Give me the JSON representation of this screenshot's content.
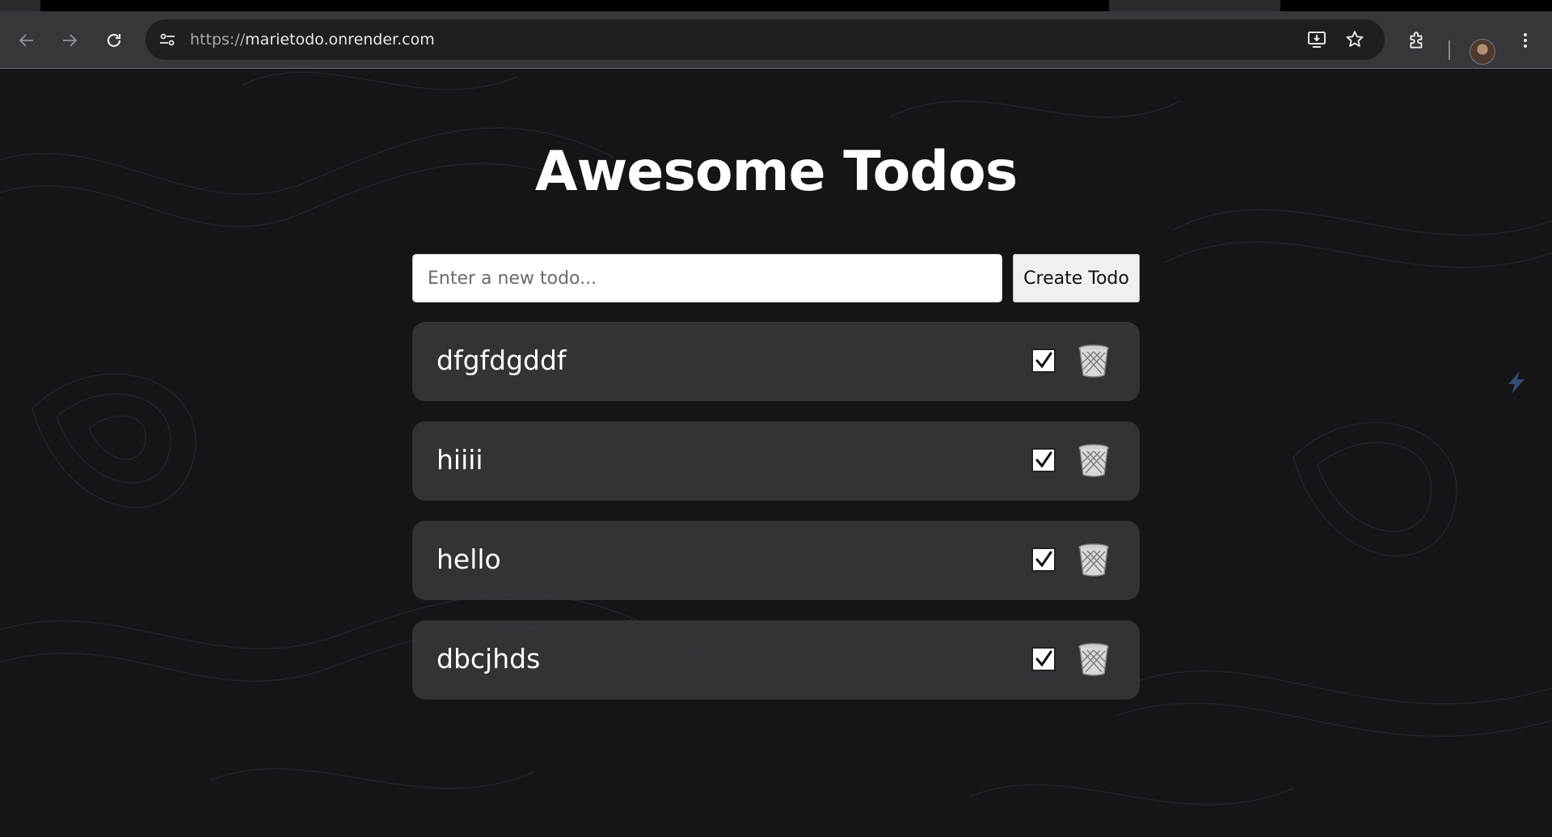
{
  "browser": {
    "url_scheme": "https://",
    "url_host": "marietodo.onrender.com"
  },
  "app": {
    "title": "Awesome Todos",
    "input_placeholder": "Enter a new todo...",
    "input_value": "",
    "create_button_label": "Create Todo",
    "todos": [
      {
        "text": "dfgfdgddf",
        "completed": false
      },
      {
        "text": "hiiii",
        "completed": false
      },
      {
        "text": "hello",
        "completed": false
      },
      {
        "text": "dbcjhds",
        "completed": false
      }
    ]
  },
  "icons": {
    "nav": [
      "back-icon",
      "forward-icon",
      "reload-icon",
      "site-info-icon"
    ],
    "toolbar": [
      "install-app-icon",
      "bookmark-star-icon",
      "extensions-icon",
      "avatar",
      "menu-icon"
    ],
    "todo_actions": [
      "checkbox-icon",
      "trash-icon"
    ]
  },
  "colors": {
    "background": "#161418",
    "card": "#3a393e",
    "title": "#ffffff",
    "accent_bolt": "#3b5b8c"
  }
}
